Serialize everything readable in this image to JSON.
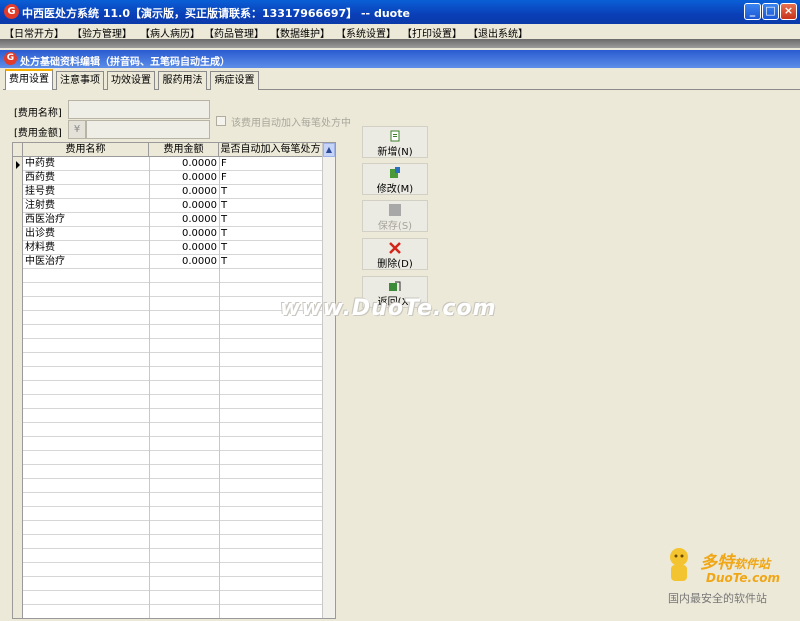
{
  "window": {
    "title": "中西医处方系统 11.0【演示版，买正版请联系：13317966697】 -- duote",
    "app_icon": "app-logo-icon",
    "min_label": "_",
    "max_label": "□",
    "close_label": "×"
  },
  "menu": [
    "【日常开方】",
    "【验方管理】",
    "【病人病历】",
    "【药品管理】",
    "【数据维护】",
    "【系统设置】",
    "【打印设置】",
    "【退出系统】"
  ],
  "subwindow": {
    "title": "处方基础资料编辑（拼音码、五笔码自动生成）"
  },
  "tabs": [
    "费用设置",
    "注意事项",
    "功效设置",
    "服药用法",
    "病症设置"
  ],
  "form": {
    "name_label": "[费用名称]",
    "amount_label": "[费用金额]",
    "amount_prefix": "¥",
    "auto_add_label": "该费用自动加入每笔处方中"
  },
  "grid": {
    "columns": [
      "费用名称",
      "费用金额",
      "是否自动加入每笔处方"
    ],
    "rows": [
      [
        "中药费",
        "0.0000",
        "F"
      ],
      [
        "西药费",
        "0.0000",
        "F"
      ],
      [
        "挂号费",
        "0.0000",
        "T"
      ],
      [
        "注射费",
        "0.0000",
        "T"
      ],
      [
        "西医治疗",
        "0.0000",
        "T"
      ],
      [
        "出诊费",
        "0.0000",
        "T"
      ],
      [
        "材料费",
        "0.0000",
        "T"
      ],
      [
        "中医治疗",
        "0.0000",
        "T"
      ]
    ]
  },
  "actions": {
    "add": "新增(N)",
    "edit": "修改(M)",
    "save": "保存(S)",
    "delete": "删除(D)",
    "back": "返回(X)"
  },
  "watermark": "www.DuoTe.com",
  "brand": {
    "name": "多特",
    "name_suffix": "软件站",
    "domain": "DuoTe.com",
    "slogan": "国内最安全的软件站"
  }
}
